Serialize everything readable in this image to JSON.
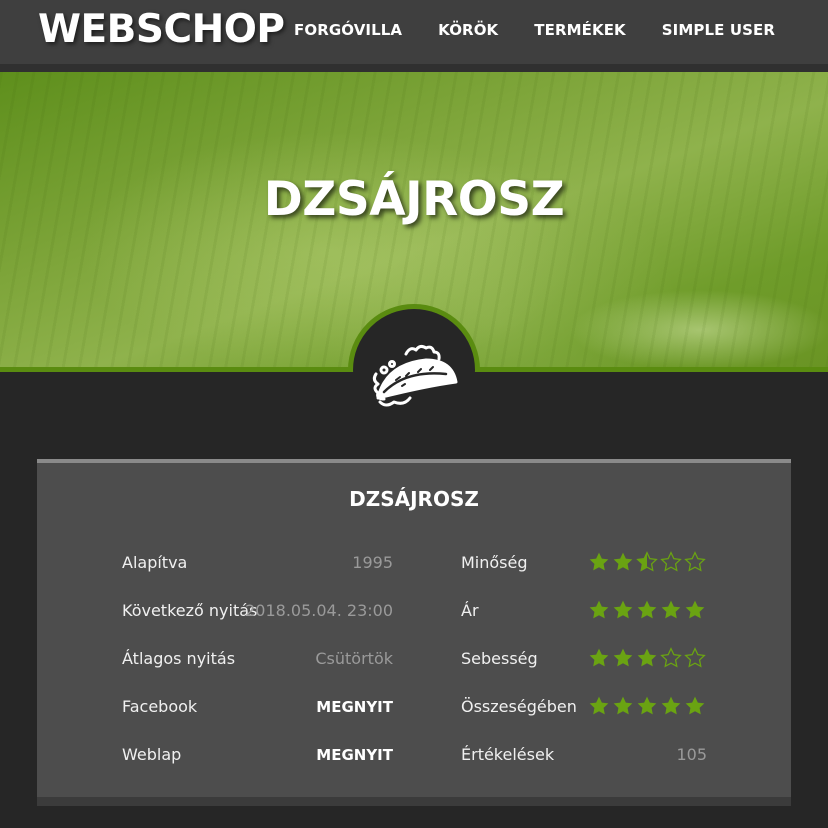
{
  "brand": "WEBSCHOP",
  "nav": [
    {
      "label": "FORGÓVILLA"
    },
    {
      "label": "KÖRÖK"
    },
    {
      "label": "TERMÉKEK"
    },
    {
      "label": "SIMPLE USER"
    }
  ],
  "hero": {
    "title": "DZSÁJROSZ",
    "icon": "taco-icon"
  },
  "card": {
    "title": "DZSÁJROSZ",
    "info": [
      {
        "label": "Alapítva",
        "value": "1995"
      },
      {
        "label": "Következő nyitás",
        "value": "2018.05.04. 23:00"
      },
      {
        "label": "Átlagos nyitás",
        "value": "Csütörtök"
      },
      {
        "label": "Facebook",
        "value": "MEGNYIT"
      },
      {
        "label": "Weblap",
        "value": "MEGNYIT"
      }
    ],
    "ratings": [
      {
        "label": "Minőség",
        "rating": 2.5
      },
      {
        "label": "Ár",
        "rating": 5
      },
      {
        "label": "Sebesség",
        "rating": 3
      },
      {
        "label": "Összeségében",
        "rating": 5
      }
    ],
    "reviews": {
      "label": "Értékelések",
      "value": "105"
    }
  },
  "colors": {
    "accent": "#5a8c10",
    "star": "#6aa312",
    "background": "#262626",
    "card": "#4d4d4d",
    "navbar": "#3f3f3f"
  }
}
